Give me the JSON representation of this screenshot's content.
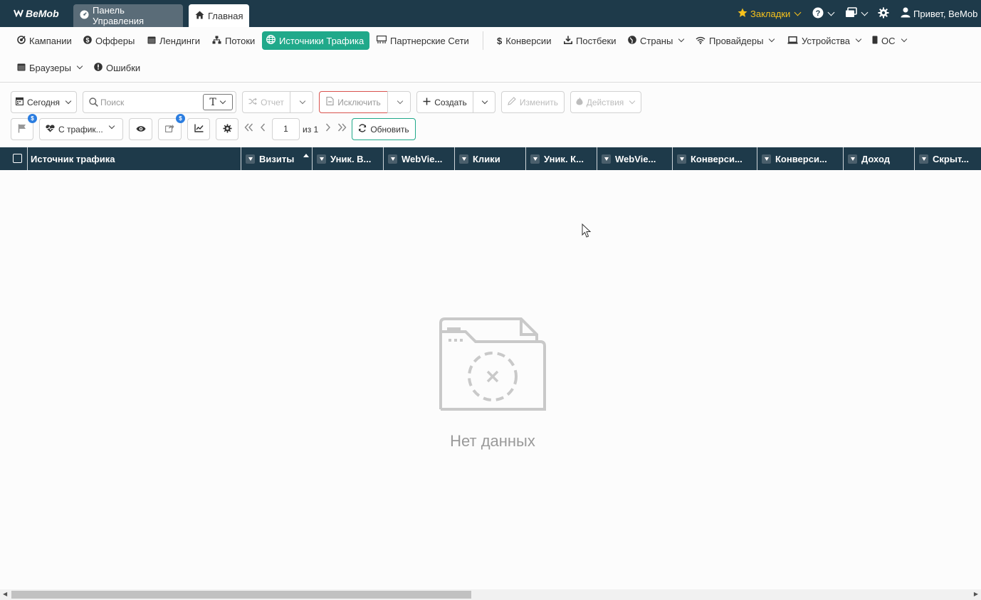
{
  "topbar": {
    "logo": "BeMob",
    "tabs": [
      {
        "label": "Панель Управления",
        "icon": "dashboard-icon"
      },
      {
        "label": "Главная",
        "icon": "home-icon"
      }
    ],
    "bookmarks_label": "Закладки",
    "user_label": "Привет, BeMob",
    "accent_color": "#f7c21c",
    "background_color": "#1e3a4a"
  },
  "nav": {
    "items": [
      {
        "label": "Кампании",
        "icon": "campaign-icon"
      },
      {
        "label": "Офферы",
        "icon": "dollar-circle-icon"
      },
      {
        "label": "Лендинги",
        "icon": "landing-icon"
      },
      {
        "label": "Потоки",
        "icon": "flows-icon"
      },
      {
        "label": "Источники Трафика",
        "icon": "globe-icon",
        "active": true
      },
      {
        "label": "Партнерские Сети",
        "icon": "network-icon"
      },
      {
        "label": "Конверсии",
        "icon": "dollar-icon"
      },
      {
        "label": "Постбеки",
        "icon": "download-icon"
      },
      {
        "label": "Страны",
        "icon": "globe-icon"
      },
      {
        "label": "Провайдеры",
        "icon": "wifi-icon"
      },
      {
        "label": "Устройства",
        "icon": "laptop-icon"
      },
      {
        "label": "ОС",
        "icon": "phone-icon"
      },
      {
        "label": "Браузеры",
        "icon": "browser-icon"
      },
      {
        "label": "Ошибки",
        "icon": "error-icon"
      }
    ],
    "active_color": "#20a98a"
  },
  "toolbar": {
    "date_label": "Сегодня",
    "search_placeholder": "Поиск",
    "search_type_label": "T",
    "report_label": "Отчет",
    "exclude_label": "Исключить",
    "create_label": "Создать",
    "edit_label": "Изменить",
    "actions_label": "Действия",
    "traffic_filter_label": "С трафик...",
    "badge_symbol": "$",
    "page_value": "1",
    "of_label": "из 1",
    "refresh_label": "Обновить"
  },
  "table": {
    "columns": [
      "Источник трафика",
      "Визиты",
      "Уник. В...",
      "WebVie...",
      "Клики",
      "Уник. К...",
      "WebVie...",
      "Конверси...",
      "Конверси...",
      "Доход",
      "Скрыт..."
    ],
    "sorted_column": "Визиты",
    "empty_text": "Нет данных"
  }
}
